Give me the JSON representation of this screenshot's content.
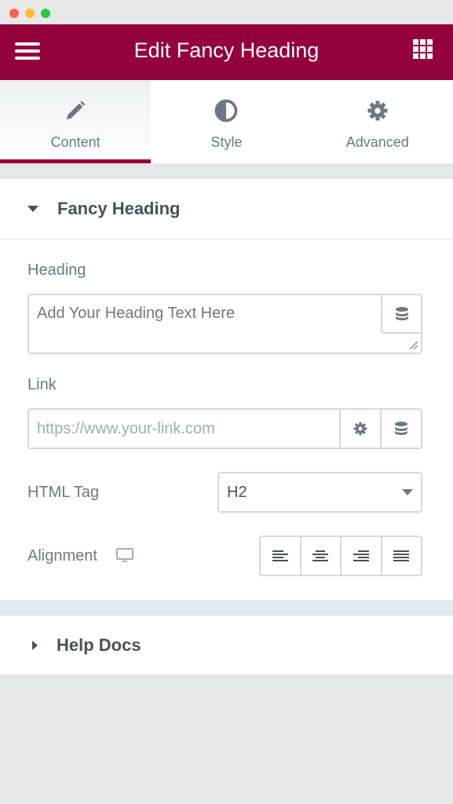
{
  "window": {
    "controls": [
      "#ff5f57",
      "#febc2e",
      "#28c840"
    ]
  },
  "header": {
    "title": "Edit Fancy Heading",
    "menu_icon": "hamburger-icon",
    "apps_icon": "grid-icon",
    "color": "#93003c"
  },
  "tabs": [
    {
      "label": "Content",
      "icon": "pencil-icon",
      "active": true
    },
    {
      "label": "Style",
      "icon": "half-circle-icon"
    },
    {
      "label": "Advanced",
      "icon": "gear-icon"
    }
  ],
  "section": {
    "title": "Fancy Heading",
    "expanded": true,
    "heading": {
      "label": "Heading",
      "value": "Add Your Heading Text Here"
    },
    "link": {
      "label": "Link",
      "placeholder": "https://www.your-link.com"
    },
    "html_tag": {
      "label": "HTML Tag",
      "value": "H2"
    },
    "alignment": {
      "label": "Alignment",
      "options": [
        "left",
        "center",
        "right",
        "justify"
      ]
    }
  },
  "help": {
    "title": "Help Docs",
    "expanded": false
  }
}
